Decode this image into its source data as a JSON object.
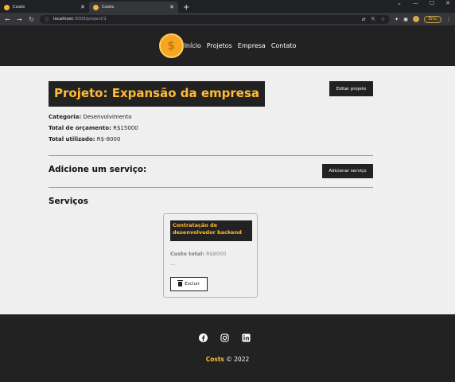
{
  "browser": {
    "tabs": [
      {
        "title": "Costs",
        "active": false
      },
      {
        "title": "Costs",
        "active": true
      }
    ],
    "new_tab": "+",
    "window_controls": [
      "⌄",
      "—",
      "☐",
      "✕"
    ],
    "url_host": "localhost",
    "url_path": ":3000/project/1",
    "profile_label": "Erro"
  },
  "navbar": {
    "logo_symbol": "$",
    "links": [
      "Início",
      "Projetos",
      "Empresa",
      "Contato"
    ]
  },
  "project": {
    "title": "Projeto: Expansão da empresa",
    "edit_label": "Editar projeto",
    "category_label": "Categoria:",
    "category_value": "Desenvolvimento",
    "budget_label": "Total de orçamento:",
    "budget_value": "R$15000",
    "used_label": "Total utilizado:",
    "used_value": "R$-8000"
  },
  "add_service": {
    "title": "Adicione um serviço:",
    "button_label": "Adicionar serviço"
  },
  "services": {
    "title": "Serviços",
    "items": [
      {
        "name": "Contratação de desenvolvedor backend",
        "cost_label": "Custo total:",
        "cost_value": "R$8000",
        "description": "...",
        "delete_label": "Excluir"
      }
    ]
  },
  "footer": {
    "social_icons": [
      "facebook-icon",
      "instagram-icon",
      "linkedin-icon"
    ],
    "brand": "Costs",
    "copyright": "© 2022"
  },
  "colors": {
    "accent": "#ffbb33",
    "dark": "#222222",
    "background": "#efefef"
  }
}
